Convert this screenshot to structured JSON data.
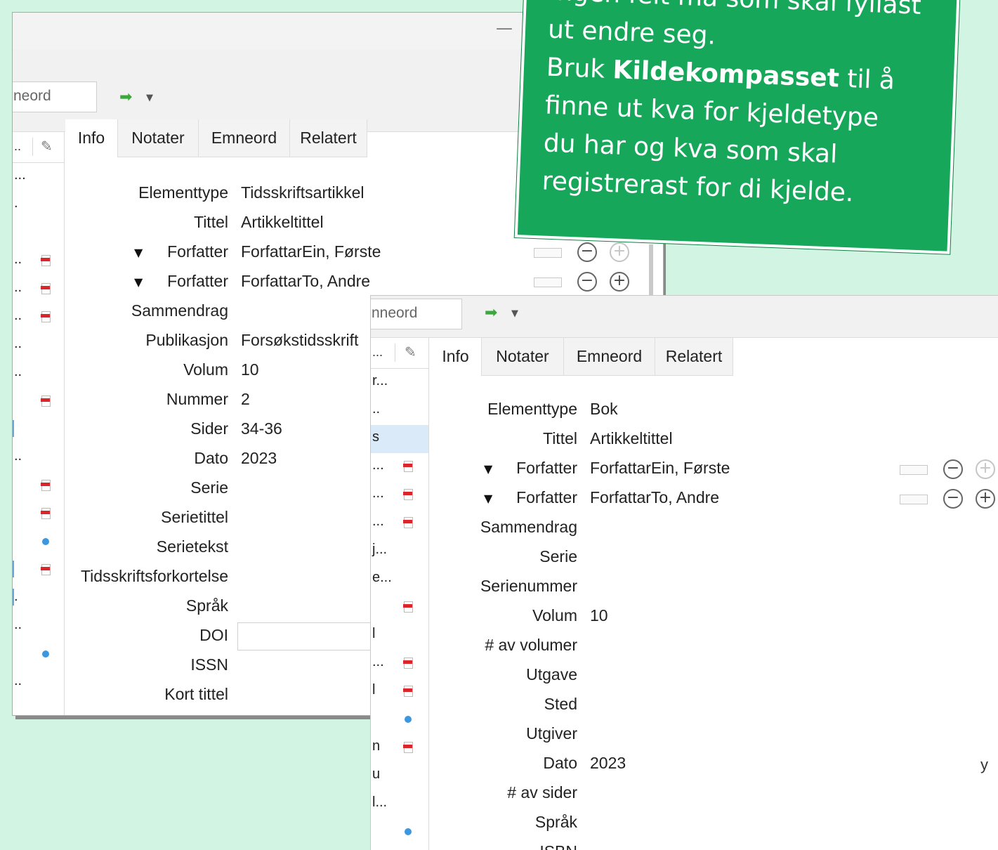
{
  "callout": {
    "line0": "Ingen felt må som skal fyllast",
    "line1": "ut endre seg.",
    "line2_pre": "Bruk ",
    "line2_bold": "Kildekompasset",
    "line2_post": " til å",
    "line3": "finne ut kva for kjeldetype",
    "line4": "du har og kva som skal",
    "line5": "registrerast for di kjelde."
  },
  "window1": {
    "minimize_glyph": "—",
    "search_placeholder": "neord",
    "list_header_dots": "..",
    "list_rows": [
      "...",
      ".",
      "",
      "..",
      "..",
      "..",
      "..",
      "..",
      "",
      "",
      "..",
      "",
      "",
      "",
      "",
      ".",
      "..",
      "",
      ".."
    ],
    "tabs": [
      "Info",
      "Notater",
      "Emneord",
      "Relatert"
    ],
    "fields": [
      {
        "label": "Elementtype",
        "value": "Tidsskriftsartikkel"
      },
      {
        "label": "Tittel",
        "value": "Artikkeltittel"
      },
      {
        "label": "Forfatter",
        "value": "ForfattarEin, Første"
      },
      {
        "label": "Forfatter",
        "value": "ForfattarTo, Andre"
      },
      {
        "label": "Sammendrag",
        "value": ""
      },
      {
        "label": "Publikasjon",
        "value": "Forsøkstidsskrift"
      },
      {
        "label": "Volum",
        "value": "10"
      },
      {
        "label": "Nummer",
        "value": "2"
      },
      {
        "label": "Sider",
        "value": "34-36"
      },
      {
        "label": "Dato",
        "value": "2023"
      },
      {
        "label": "Serie",
        "value": ""
      },
      {
        "label": "Serietittel",
        "value": ""
      },
      {
        "label": "Serietekst",
        "value": ""
      },
      {
        "label": "Tidsskriftsforkortelse",
        "value": ""
      },
      {
        "label": "Språk",
        "value": ""
      },
      {
        "label": "DOI",
        "value": ""
      },
      {
        "label": "ISSN",
        "value": ""
      },
      {
        "label": "Kort tittel",
        "value": ""
      }
    ]
  },
  "window2": {
    "search_placeholder": "nneord",
    "list_header_dots": "...",
    "list_rows": [
      "r...",
      "..",
      "s",
      "...",
      "...",
      "...",
      "j...",
      "e...",
      "",
      "l",
      "...",
      "l",
      "",
      "n",
      "u",
      "l...",
      ""
    ],
    "tabs": [
      "Info",
      "Notater",
      "Emneord",
      "Relatert"
    ],
    "fields": [
      {
        "label": "Elementtype",
        "value": "Bok"
      },
      {
        "label": "Tittel",
        "value": "Artikkeltittel"
      },
      {
        "label": "Forfatter",
        "value": "ForfattarEin, Første"
      },
      {
        "label": "Forfatter",
        "value": "ForfattarTo, Andre"
      },
      {
        "label": "Sammendrag",
        "value": ""
      },
      {
        "label": "Serie",
        "value": ""
      },
      {
        "label": "Serienummer",
        "value": ""
      },
      {
        "label": "Volum",
        "value": "10"
      },
      {
        "label": "# av volumer",
        "value": ""
      },
      {
        "label": "Utgave",
        "value": ""
      },
      {
        "label": "Sted",
        "value": ""
      },
      {
        "label": "Utgiver",
        "value": ""
      },
      {
        "label": "Dato",
        "value": "2023"
      },
      {
        "label": "# av sider",
        "value": ""
      },
      {
        "label": "Språk",
        "value": ""
      },
      {
        "label": "ISBN",
        "value": ""
      }
    ],
    "stray_text": "y"
  }
}
